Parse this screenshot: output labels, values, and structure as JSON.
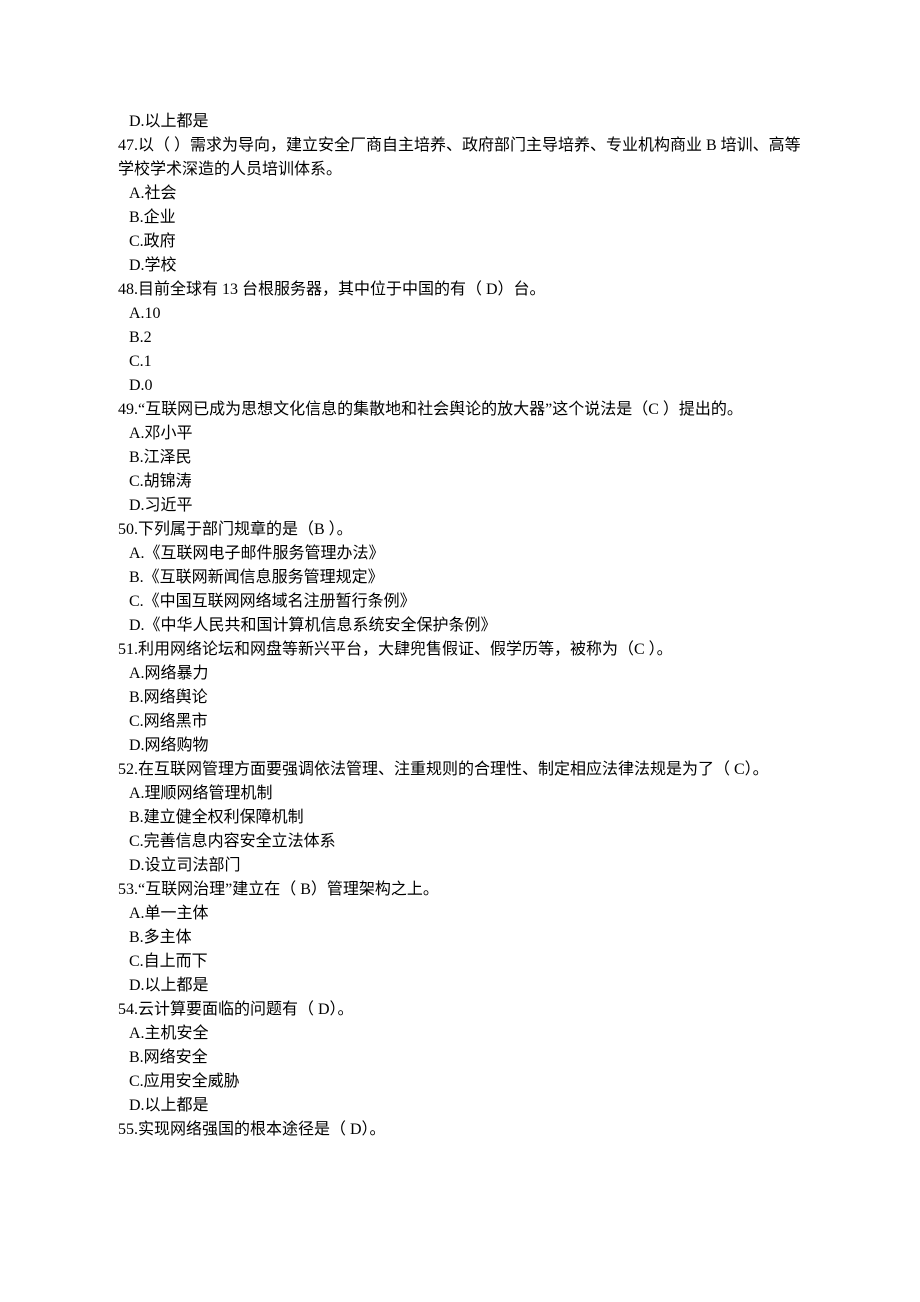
{
  "questions": [
    {
      "options": [
        "D.以上都是"
      ]
    },
    {
      "stem": "47.以（ ）需求为导向，建立安全厂商自主培养、政府部门主导培养、专业机构商业 B 培训、高等学校学术深造的人员培训体系。",
      "options": [
        "A.社会",
        "B.企业",
        "C.政府",
        "D.学校"
      ]
    },
    {
      "stem": "48.目前全球有 13 台根服务器，其中位于中国的有（ D）台。",
      "options": [
        "A.10",
        "B.2",
        "C.1",
        "D.0"
      ]
    },
    {
      "stem": "49.“互联网已成为思想文化信息的集散地和社会舆论的放大器”这个说法是（C ）提出的。",
      "options": [
        "A.邓小平",
        "B.江泽民",
        "C.胡锦涛",
        "D.习近平"
      ]
    },
    {
      "stem": "50.下列属于部门规章的是（B  ）。",
      "options": [
        "A.《互联网电子邮件服务管理办法》",
        "B.《互联网新闻信息服务管理规定》",
        "C.《中国互联网网络域名注册暂行条例》",
        "D.《中华人民共和国计算机信息系统安全保护条例》"
      ]
    },
    {
      "stem": "51.利用网络论坛和网盘等新兴平台，大肆兜售假证、假学历等，被称为（C  ）。",
      "options": [
        "A.网络暴力",
        "B.网络舆论",
        "C.网络黑市",
        "D.网络购物"
      ]
    },
    {
      "stem": "52.在互联网管理方面要强调依法管理、注重规则的合理性、制定相应法律法规是为了（  C）。",
      "options": [
        "A.理顺网络管理机制",
        "B.建立健全权利保障机制",
        "C.完善信息内容安全立法体系",
        "D.设立司法部门"
      ]
    },
    {
      "stem": "53.“互联网治理”建立在（ B）管理架构之上。",
      "options": [
        "A.单一主体",
        "B.多主体",
        "C.自上而下",
        "D.以上都是"
      ]
    },
    {
      "stem": "54.云计算要面临的问题有（ D）。",
      "options": [
        "A.主机安全",
        "B.网络安全",
        "C.应用安全威胁",
        "D.以上都是"
      ]
    },
    {
      "stem": "55.实现网络强国的根本途径是（ D）。",
      "options": []
    }
  ]
}
